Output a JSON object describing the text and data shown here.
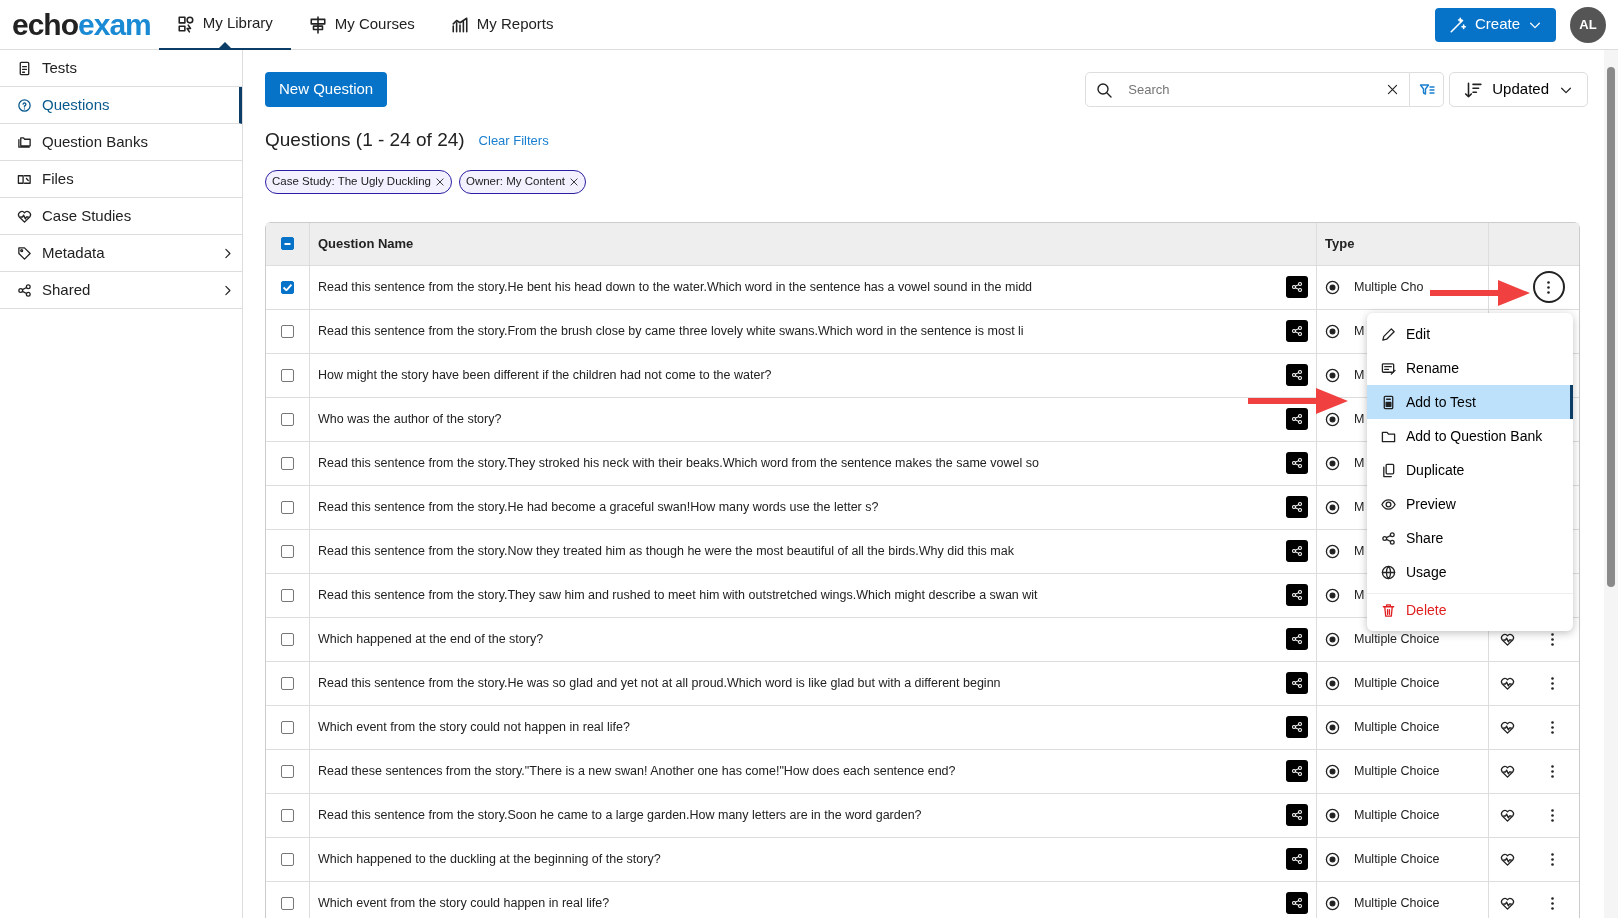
{
  "brand": {
    "part_1": "echo",
    "part_2": "exam"
  },
  "nav": [
    {
      "label": "My Library",
      "selected": true
    },
    {
      "label": "My Courses",
      "selected": false
    },
    {
      "label": "My Reports",
      "selected": false
    }
  ],
  "create_button": "Create",
  "avatar": "AL",
  "sidebar": [
    {
      "label": "Tests",
      "selected": false,
      "submenu": false
    },
    {
      "label": "Questions",
      "selected": true,
      "submenu": false
    },
    {
      "label": "Question Banks",
      "selected": false,
      "submenu": false
    },
    {
      "label": "Files",
      "selected": false,
      "submenu": false
    },
    {
      "label": "Case Studies",
      "selected": false,
      "submenu": false
    },
    {
      "label": "Metadata",
      "selected": false,
      "submenu": true
    },
    {
      "label": "Shared",
      "selected": false,
      "submenu": true
    }
  ],
  "new_button": "New Question",
  "search": {
    "placeholder": "Search"
  },
  "sort": "Updated",
  "heading": "Questions (1 - 24 of 24)",
  "clear_filters": "Clear Filters",
  "filters": [
    "Case Study: The Ugly Duckling",
    "Owner: My Content"
  ],
  "table": {
    "select_all": {
      "indeterminate": true
    },
    "columns": [
      "Question Name",
      "Type"
    ],
    "rows": [
      {
        "checked": true,
        "name": "Read this sentence from the story.He bent his head down to the water.Which word in the sentence has a vowel sound in the midd",
        "type": "Multiple Cho",
        "menu_open": true
      },
      {
        "checked": false,
        "name": "Read this sentence from the story.From the brush close by came three lovely white swans.Which word in the sentence is most li",
        "type": "M",
        "menu_open": false
      },
      {
        "checked": false,
        "name": "How might the story have been different if the children had not come to the water?",
        "type": "M",
        "menu_open": false
      },
      {
        "checked": false,
        "name": "Who was the author of the story?",
        "type": "M",
        "menu_open": false
      },
      {
        "checked": false,
        "name": "Read this sentence from the story.They stroked his neck with their beaks.Which word from the sentence makes the same vowel so",
        "type": "M",
        "menu_open": false
      },
      {
        "checked": false,
        "name": "Read this sentence from the story.He had become a graceful swan!How many words use the letter s?",
        "type": "M",
        "menu_open": false
      },
      {
        "checked": false,
        "name": "Read this sentence from the story.Now they treated him as though he were the most beautiful of all the birds.Why did this mak",
        "type": "M",
        "menu_open": false
      },
      {
        "checked": false,
        "name": "Read this sentence from the story.They saw him and rushed to meet him with outstretched wings.Which might describe a swan wit",
        "type": "M",
        "menu_open": false
      },
      {
        "checked": false,
        "name": "Which happened at the end of the story?",
        "type": "Multiple Choice",
        "menu_open": false
      },
      {
        "checked": false,
        "name": "Read this sentence from the story.He was so glad and yet not at all proud.Which word is like glad but with a different beginn",
        "type": "Multiple Choice",
        "menu_open": false
      },
      {
        "checked": false,
        "name": "Which event from the story could not happen in real life?",
        "type": "Multiple Choice",
        "menu_open": false
      },
      {
        "checked": false,
        "name": "Read these sentences from the story.\"There is a new swan! Another one has come!\"How does each sentence end?",
        "type": "Multiple Choice",
        "menu_open": false
      },
      {
        "checked": false,
        "name": "Read this sentence from the story.Soon he came to a large garden.How many letters are in the word garden?",
        "type": "Multiple Choice",
        "menu_open": false
      },
      {
        "checked": false,
        "name": "Which happened to the duckling at the beginning of the story?",
        "type": "Multiple Choice",
        "menu_open": false
      },
      {
        "checked": false,
        "name": "Which event from the story could happen in real life?",
        "type": "Multiple Choice",
        "menu_open": false
      }
    ]
  },
  "menu": [
    {
      "label": "Edit",
      "kind": "edit",
      "selected": false
    },
    {
      "label": "Rename",
      "kind": "rename",
      "selected": false
    },
    {
      "label": "Add to Test",
      "kind": "test",
      "selected": true
    },
    {
      "label": "Add to Question Bank",
      "kind": "folder",
      "selected": false
    },
    {
      "label": "Duplicate",
      "kind": "copy",
      "selected": false
    },
    {
      "label": "Preview",
      "kind": "eye",
      "selected": false
    },
    {
      "label": "Share",
      "kind": "share",
      "selected": false
    },
    {
      "label": "Usage",
      "kind": "globe",
      "selected": false
    },
    {
      "label": "Delete",
      "kind": "delete",
      "selected": false
    }
  ]
}
